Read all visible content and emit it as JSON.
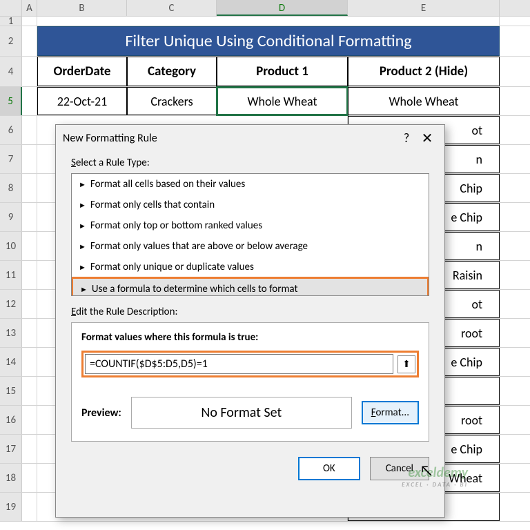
{
  "columns": {
    "A": "A",
    "B": "B",
    "C": "C",
    "D": "D",
    "E": "E"
  },
  "rows": [
    "1",
    "2",
    "4",
    "5",
    "6",
    "7",
    "8",
    "9",
    "10",
    "11",
    "12",
    "13",
    "14",
    "15",
    "16",
    "17",
    "18",
    "19"
  ],
  "title": "Filter Unique Using Conditional Formatting",
  "headers": {
    "b": "OrderDate",
    "c": "Category",
    "d": "Product 1",
    "e": "Product 2 (Hide)"
  },
  "row5": {
    "b": "22-Oct-21",
    "c": "Crackers",
    "d": "Whole Wheat",
    "e": "Whole Wheat"
  },
  "partialE": [
    "ot",
    "n",
    "Chip",
    "e Chip",
    "n",
    "Raisin",
    "ot",
    "root",
    "e Chip",
    "",
    "root",
    "e Chip",
    "Wheat",
    ""
  ],
  "dialog": {
    "title": "New Formatting Rule",
    "help": "?",
    "close": "✕",
    "selectLabel": "Select a Rule Type:",
    "rules": [
      "Format all cells based on their values",
      "Format only cells that contain",
      "Format only top or bottom ranked values",
      "Format only values that are above or below average",
      "Format only unique or duplicate values",
      "Use a formula to determine which cells to format"
    ],
    "editLabel": "Edit the Rule Description:",
    "formulaLabel": "Format values where this formula is true:",
    "formula": "=COUNTIF($D$5:D5,D5)=1",
    "previewLabel": "Preview:",
    "previewText": "No Format Set",
    "formatBtn": "Format...",
    "ok": "OK",
    "cancel": "Cancel"
  },
  "watermark": {
    "main": "exceldemy",
    "sub": "EXCEL · DATA · BI"
  }
}
